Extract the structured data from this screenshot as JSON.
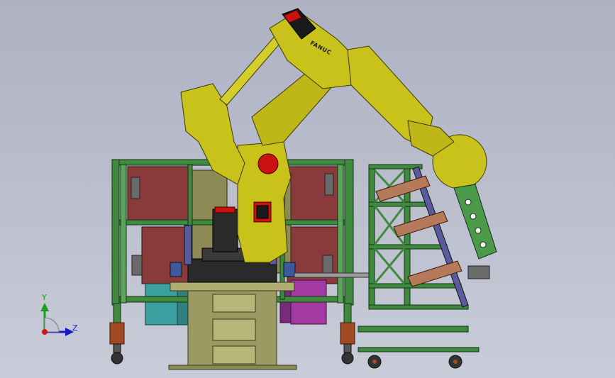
{
  "viewport": {
    "background_top": "#aeb1c2",
    "background_bottom": "#c9ccd8"
  },
  "robot": {
    "brand_text": "FANUC",
    "body_color": "#c8c21a",
    "accent_color": "#cc1111"
  },
  "triad": {
    "y_label": "Y",
    "z_label": "Z",
    "y_color": "#19a019",
    "z_color": "#1818c8",
    "origin_color": "#c81818"
  },
  "colors": {
    "frame_green": "#3f8a3f",
    "panel_maroon": "#8a3a3a",
    "panel_teal": "#3aa0a0",
    "panel_magenta": "#a33aa3",
    "pedestal_olive": "#9a9a62"
  }
}
